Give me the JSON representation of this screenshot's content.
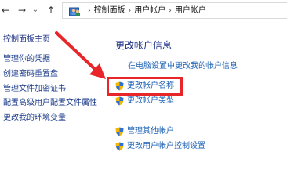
{
  "nav": {
    "back": "←",
    "forward": "→",
    "dropdown": "⌄",
    "up": "↑"
  },
  "breadcrumb": [
    "控制面板",
    "用户帐户",
    "用户帐户"
  ],
  "sidebar": [
    "控制面板主页",
    "管理你的凭据",
    "创建密码重置盘",
    "管理文件加密证书",
    "配置高级用户配置文件属性",
    "更改我的环境变量"
  ],
  "main": {
    "title": "更改帐户信息",
    "pc_settings_link": "在电脑设置中更改我的帐户信息",
    "actions": [
      "更改帐户名称",
      "更改帐户类型"
    ],
    "other": [
      "管理其他帐户",
      "更改用户帐户控制设置"
    ]
  },
  "colors": {
    "accent": "#e8262a",
    "link": "#1a5fb4",
    "title": "#1e3287"
  }
}
